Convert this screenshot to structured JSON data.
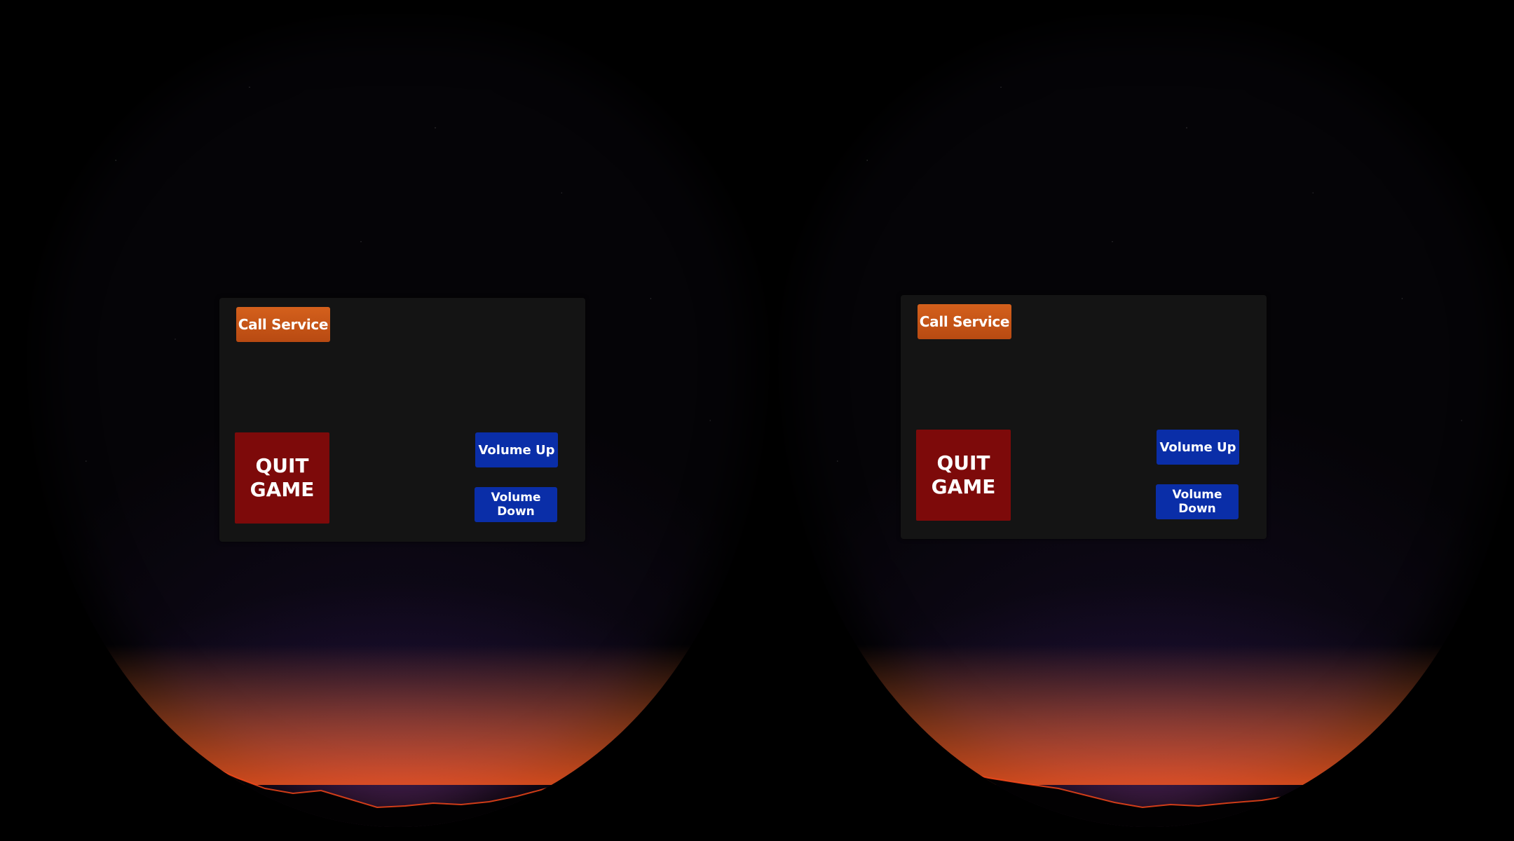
{
  "vr_menu": {
    "call_service_label": "Call Service",
    "quit_game_label": "QUIT\nGAME",
    "volume_up_label": "Volume Up",
    "volume_down_label": "Volume\nDown"
  },
  "colors": {
    "call_service": "#c4561a",
    "quit_game": "#7d0a0a",
    "volume_buttons": "#0a2ea8",
    "panel": "#141414"
  }
}
